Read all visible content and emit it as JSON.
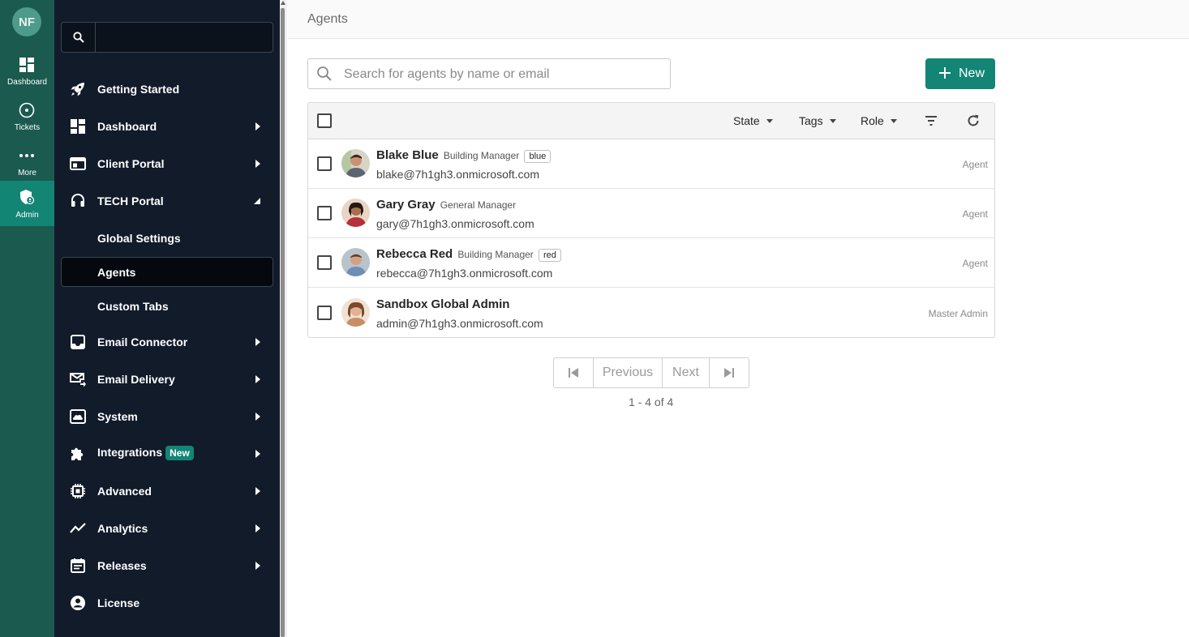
{
  "rail": {
    "avatar_initials": "NF",
    "items": [
      {
        "label": "Dashboard",
        "icon": "dashboard-icon"
      },
      {
        "label": "Tickets",
        "icon": "ticket-icon"
      },
      {
        "label": "More",
        "icon": "more-icon"
      },
      {
        "label": "Admin",
        "icon": "admin-shield-icon"
      }
    ]
  },
  "sidebar": {
    "search_placeholder": "",
    "items": [
      {
        "label": "Getting Started",
        "icon": "rocket-icon"
      },
      {
        "label": "Dashboard",
        "icon": "dashboard-icon"
      },
      {
        "label": "Client Portal",
        "icon": "browser-window-icon"
      },
      {
        "label": "TECH Portal",
        "icon": "headset-icon"
      },
      {
        "label": "Global Settings"
      },
      {
        "label": "Agents"
      },
      {
        "label": "Custom Tabs"
      },
      {
        "label": "Email Connector",
        "icon": "inbox-icon"
      },
      {
        "label": "Email Delivery",
        "icon": "email-send-icon"
      },
      {
        "label": "System",
        "icon": "cloud-icon"
      },
      {
        "label": "Integrations",
        "icon": "puzzle-icon",
        "badge": "New"
      },
      {
        "label": "Advanced",
        "icon": "chip-icon"
      },
      {
        "label": "Analytics",
        "icon": "trend-line-icon"
      },
      {
        "label": "Releases",
        "icon": "calendar-icon"
      },
      {
        "label": "License",
        "icon": "account-circle-icon"
      }
    ]
  },
  "header": {
    "title": "Agents"
  },
  "toolbar": {
    "search_placeholder": "Search for agents by name or email",
    "search_value": "",
    "new_label": "New"
  },
  "table": {
    "filters": {
      "state": "State",
      "tags": "Tags",
      "role": "Role"
    },
    "rows": [
      {
        "name": "Blake Blue",
        "title": "Building Manager",
        "tag": "blue",
        "email": "blake@7h1gh3.onmicrosoft.com",
        "role": "Agent"
      },
      {
        "name": "Gary Gray",
        "title": "General Manager",
        "tag": "",
        "email": "gary@7h1gh3.onmicrosoft.com",
        "role": "Agent"
      },
      {
        "name": "Rebecca Red",
        "title": "Building Manager",
        "tag": "red",
        "email": "rebecca@7h1gh3.onmicrosoft.com",
        "role": "Agent"
      },
      {
        "name": "Sandbox Global Admin",
        "title": "",
        "tag": "",
        "email": "admin@7h1gh3.onmicrosoft.com",
        "role": "Master Admin"
      }
    ]
  },
  "pagination": {
    "previous": "Previous",
    "next": "Next",
    "range": "1 - 4 of 4"
  },
  "colors": {
    "rail_bg": "#1b5a4e",
    "accent": "#128575",
    "sidebar_bg": "#121b2a"
  }
}
